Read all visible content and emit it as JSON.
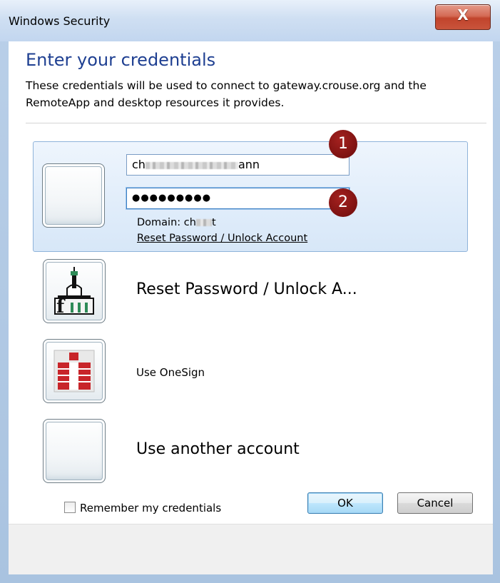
{
  "window": {
    "title": "Windows Security",
    "close_label": "X"
  },
  "dialog": {
    "heading": "Enter your credentials",
    "description": "These credentials will be used to connect to gateway.crouse.org and the RemoteApp and desktop resources it provides."
  },
  "credential_tile": {
    "username_prefix": "ch",
    "username_suffix": "ann",
    "password_masked": "●●●●●●●●●",
    "domain_label": "Domain: ",
    "domain_prefix": "ch",
    "domain_suffix": "t",
    "reset_link": "Reset Password / Unlock Account",
    "badge_1": "1",
    "badge_2": "2"
  },
  "options": [
    {
      "label": "Reset Password / Unlock A...",
      "icon": "building-icon"
    },
    {
      "label": "Use OneSign",
      "icon": "onesign-icon"
    },
    {
      "label": "Use another account",
      "icon": "blank-avatar-icon"
    }
  ],
  "remember_label": "Remember my credentials",
  "buttons": {
    "ok": "OK",
    "cancel": "Cancel"
  },
  "colors": {
    "heading": "#1e3f91",
    "badge": "#7d1211",
    "onesign_red": "#c8252a",
    "close_red": "#c1442c"
  }
}
